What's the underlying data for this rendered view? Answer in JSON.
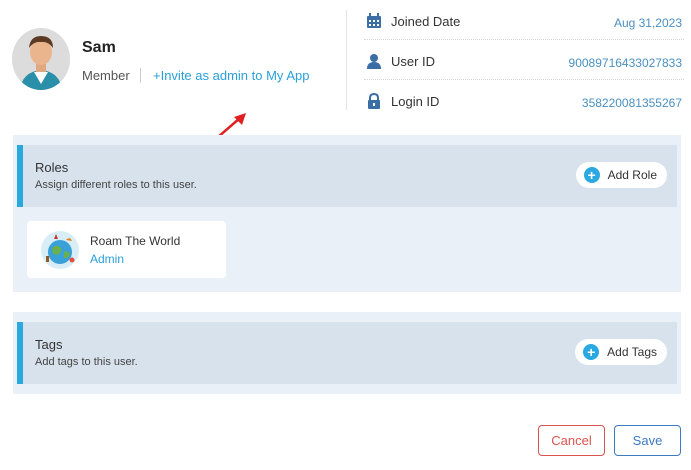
{
  "profile": {
    "name": "Sam",
    "role": "Member",
    "invite_link": "+Invite as admin to My App"
  },
  "info": {
    "joined_label": "Joined Date",
    "joined_value": "Aug 31,2023",
    "user_id_label": "User ID",
    "user_id_value": "90089716433027833",
    "login_id_label": "Login ID",
    "login_id_value": "358220081355267"
  },
  "roles": {
    "title": "Roles",
    "subtitle": "Assign different roles to this user.",
    "add_label": "Add Role",
    "items": [
      {
        "app": "Roam The World",
        "role": "Admin"
      }
    ]
  },
  "tags": {
    "title": "Tags",
    "subtitle": "Add tags to this user.",
    "add_label": "Add Tags"
  },
  "footer": {
    "cancel_label": "Cancel",
    "save_label": "Save"
  },
  "colors": {
    "accent": "#2aa8e0",
    "link": "#2aa0d8",
    "panel_bg": "#eaf0f7",
    "header_bg": "#d8e2ec",
    "cancel": "#d9534f",
    "save": "#3b7bc0",
    "annotation_arrow": "#e02020"
  }
}
